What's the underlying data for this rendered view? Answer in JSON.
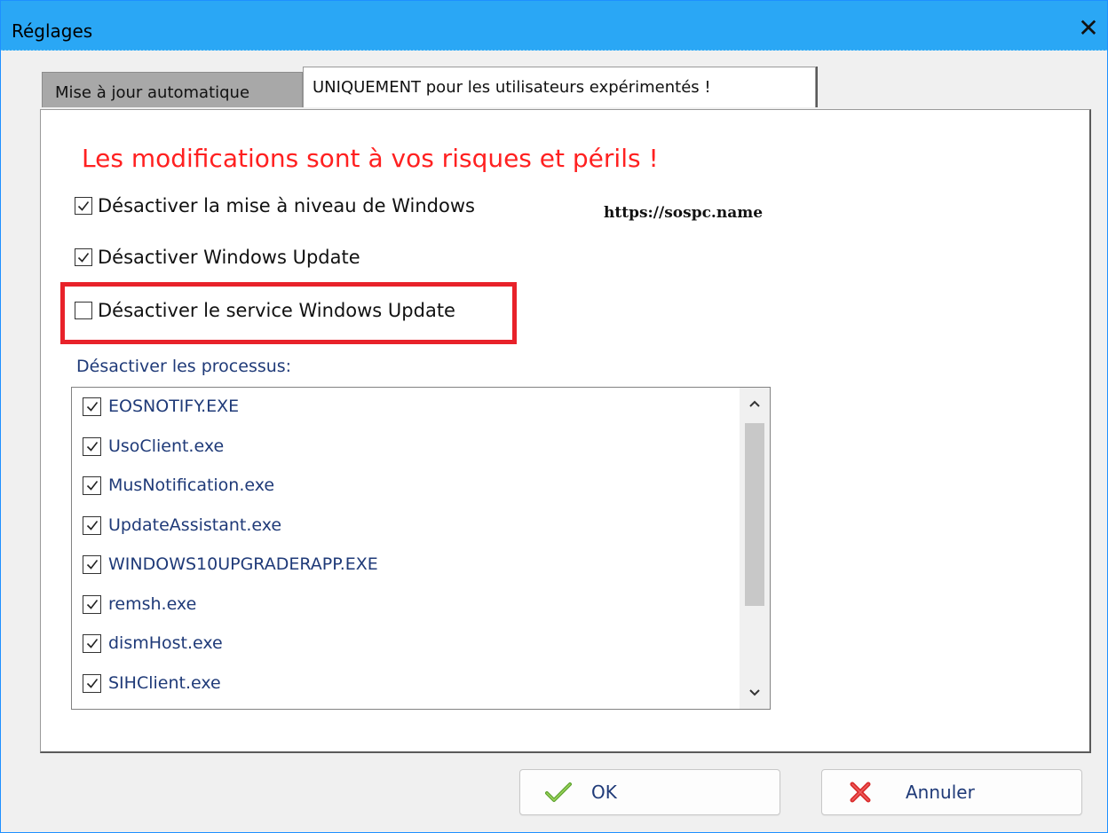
{
  "window": {
    "title": "Réglages",
    "close_glyph": "✕"
  },
  "tabs": [
    {
      "label": "Mise à jour automatique",
      "active": false
    },
    {
      "label": "UNIQUEMENT pour les utilisateurs expérimentés !",
      "active": true
    }
  ],
  "panel": {
    "warning": "Les modifications sont à vos risques et périls !",
    "site": "https://sospc.name",
    "options": [
      {
        "label": "Désactiver la mise à niveau de Windows",
        "checked": true
      },
      {
        "label": "Désactiver Windows Update",
        "checked": true
      },
      {
        "label": "Désactiver le service Windows Update",
        "checked": false
      }
    ],
    "processes_label": "Désactiver les processus:",
    "processes": [
      {
        "label": "EOSNOTIFY.EXE",
        "checked": true
      },
      {
        "label": "UsoClient.exe",
        "checked": true
      },
      {
        "label": "MusNotification.exe",
        "checked": true
      },
      {
        "label": "UpdateAssistant.exe",
        "checked": true
      },
      {
        "label": "WINDOWS10UPGRADERAPP.EXE",
        "checked": true
      },
      {
        "label": "remsh.exe",
        "checked": true
      },
      {
        "label": "dismHost.exe",
        "checked": true
      },
      {
        "label": "SIHClient.exe",
        "checked": true
      }
    ]
  },
  "buttons": {
    "ok_label": "OK",
    "cancel_label": "Annuler"
  },
  "colors": {
    "titlebar": "#2aa7f5",
    "warning": "#ff2020",
    "highlight": "#e8222a",
    "list_text": "#1f3a78"
  },
  "icons": {
    "ok": "checkmark-icon",
    "cancel": "red-x-icon",
    "close": "close-icon"
  }
}
